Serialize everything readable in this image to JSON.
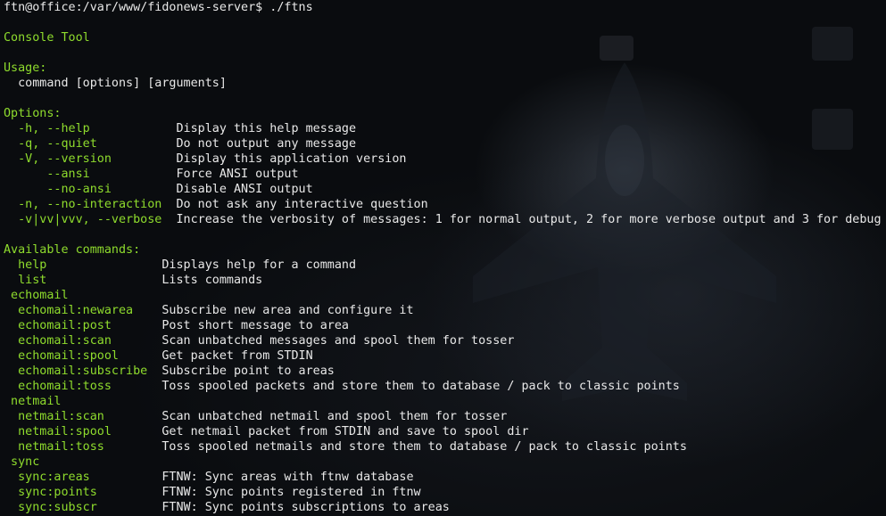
{
  "prompt": "ftn@office:/var/www/fidonews-server$ ./ftns",
  "title": "Console Tool",
  "usage_header": "Usage:",
  "usage_line": "  command [options] [arguments]",
  "options_header": "Options:",
  "options": [
    {
      "flag": "  -h, --help            ",
      "desc": "Display this help message"
    },
    {
      "flag": "  -q, --quiet           ",
      "desc": "Do not output any message"
    },
    {
      "flag": "  -V, --version         ",
      "desc": "Display this application version"
    },
    {
      "flag": "      --ansi            ",
      "desc": "Force ANSI output"
    },
    {
      "flag": "      --no-ansi         ",
      "desc": "Disable ANSI output"
    },
    {
      "flag": "  -n, --no-interaction  ",
      "desc": "Do not ask any interactive question"
    },
    {
      "flag": "  -v|vv|vvv, --verbose  ",
      "desc": "Increase the verbosity of messages: 1 for normal output, 2 for more verbose output and 3 for debug"
    }
  ],
  "commands_header": "Available commands:",
  "commands": [
    {
      "name": "  help                ",
      "desc": "Displays help for a command",
      "kind": "command"
    },
    {
      "name": "  list                ",
      "desc": "Lists commands",
      "kind": "command"
    },
    {
      "name": " echomail",
      "desc": "",
      "kind": "group"
    },
    {
      "name": "  echomail:newarea    ",
      "desc": "Subscribe new area and configure it",
      "kind": "command"
    },
    {
      "name": "  echomail:post       ",
      "desc": "Post short message to area",
      "kind": "command"
    },
    {
      "name": "  echomail:scan       ",
      "desc": "Scan unbatched messages and spool them for tosser",
      "kind": "command"
    },
    {
      "name": "  echomail:spool      ",
      "desc": "Get packet from STDIN",
      "kind": "command"
    },
    {
      "name": "  echomail:subscribe  ",
      "desc": "Subscribe point to areas",
      "kind": "command"
    },
    {
      "name": "  echomail:toss       ",
      "desc": "Toss spooled packets and store them to database / pack to classic points",
      "kind": "command"
    },
    {
      "name": " netmail",
      "desc": "",
      "kind": "group"
    },
    {
      "name": "  netmail:scan        ",
      "desc": "Scan unbatched netmail and spool them for tosser",
      "kind": "command"
    },
    {
      "name": "  netmail:spool       ",
      "desc": "Get netmail packet from STDIN and save to spool dir",
      "kind": "command"
    },
    {
      "name": "  netmail:toss        ",
      "desc": "Toss spooled netmails and store them to database / pack to classic points",
      "kind": "command"
    },
    {
      "name": " sync",
      "desc": "",
      "kind": "group"
    },
    {
      "name": "  sync:areas          ",
      "desc": "FTNW: Sync areas with ftnw database",
      "kind": "command"
    },
    {
      "name": "  sync:points         ",
      "desc": "FTNW: Sync points registered in ftnw",
      "kind": "command"
    },
    {
      "name": "  sync:subscr         ",
      "desc": "FTNW: Sync points subscriptions to areas",
      "kind": "command"
    }
  ],
  "colors": {
    "accent_green": "#8fdc2d",
    "text": "#e8e8e8",
    "background": "#0a0c0f"
  }
}
